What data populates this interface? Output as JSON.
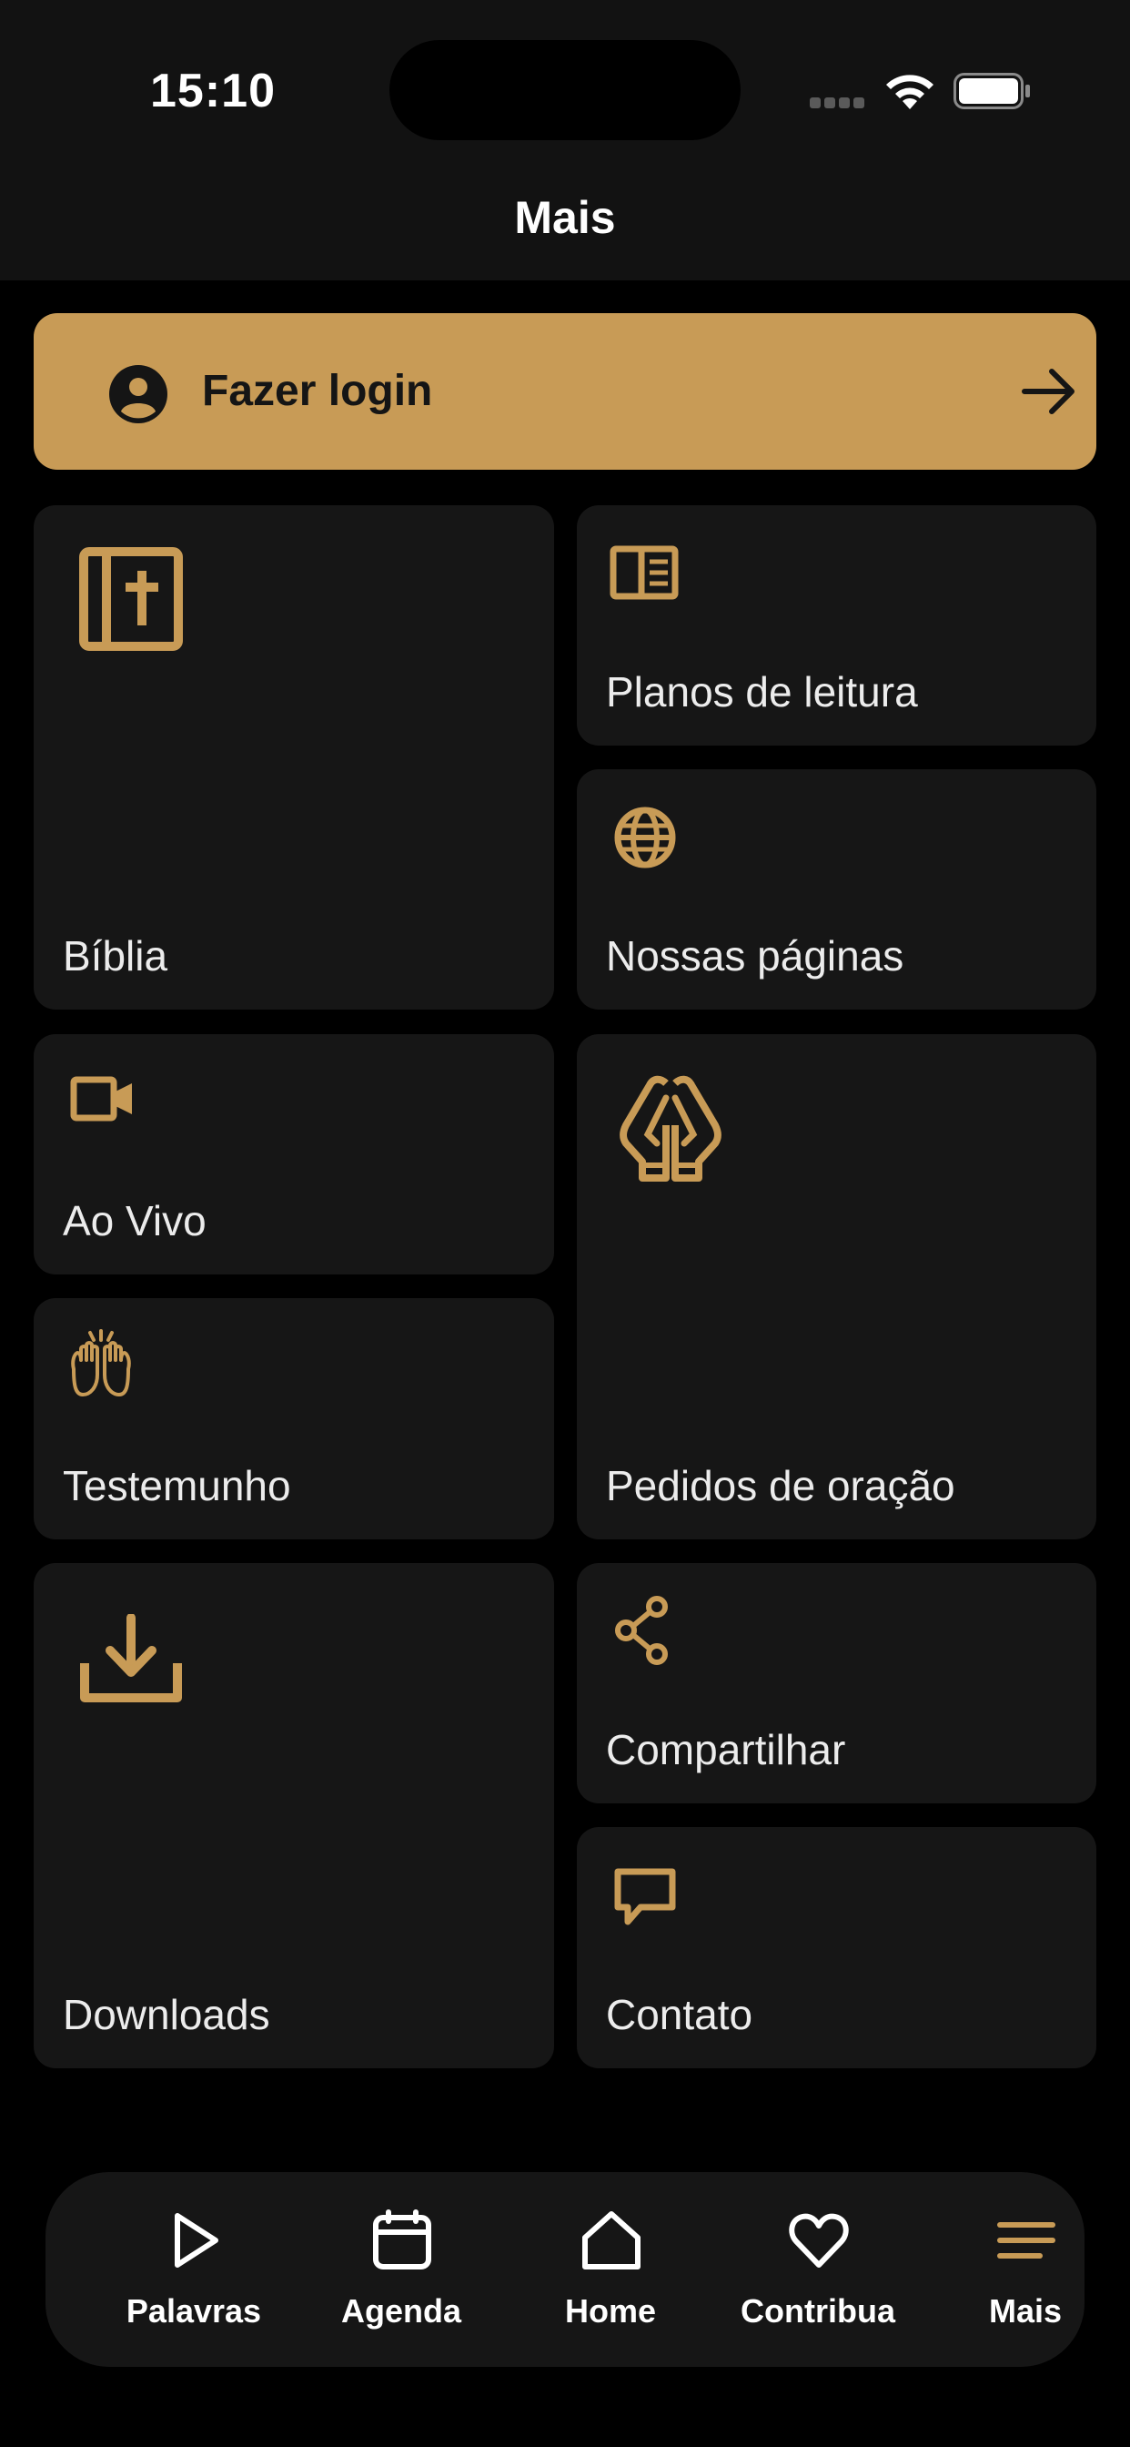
{
  "status_bar": {
    "time": "15:10"
  },
  "header": {
    "title": "Mais"
  },
  "login": {
    "label": "Fazer login"
  },
  "tiles": {
    "biblia": "Bíblia",
    "planos": "Planos de leitura",
    "paginas": "Nossas páginas",
    "aovivo": "Ao Vivo",
    "oracao": "Pedidos de oração",
    "testemunho": "Testemunho",
    "downloads": "Downloads",
    "compartilhar": "Compartilhar",
    "contato": "Contato"
  },
  "nav": {
    "items": [
      {
        "label": "Palavras",
        "icon": "play-icon"
      },
      {
        "label": "Agenda",
        "icon": "calendar-icon"
      },
      {
        "label": "Home",
        "icon": "home-icon"
      },
      {
        "label": "Contribua",
        "icon": "heart-icon"
      },
      {
        "label": "Mais",
        "icon": "menu-icon",
        "active": true
      }
    ]
  },
  "colors": {
    "accent": "#c89b56",
    "background": "#000000",
    "tile": "#161616",
    "header": "#121212"
  }
}
